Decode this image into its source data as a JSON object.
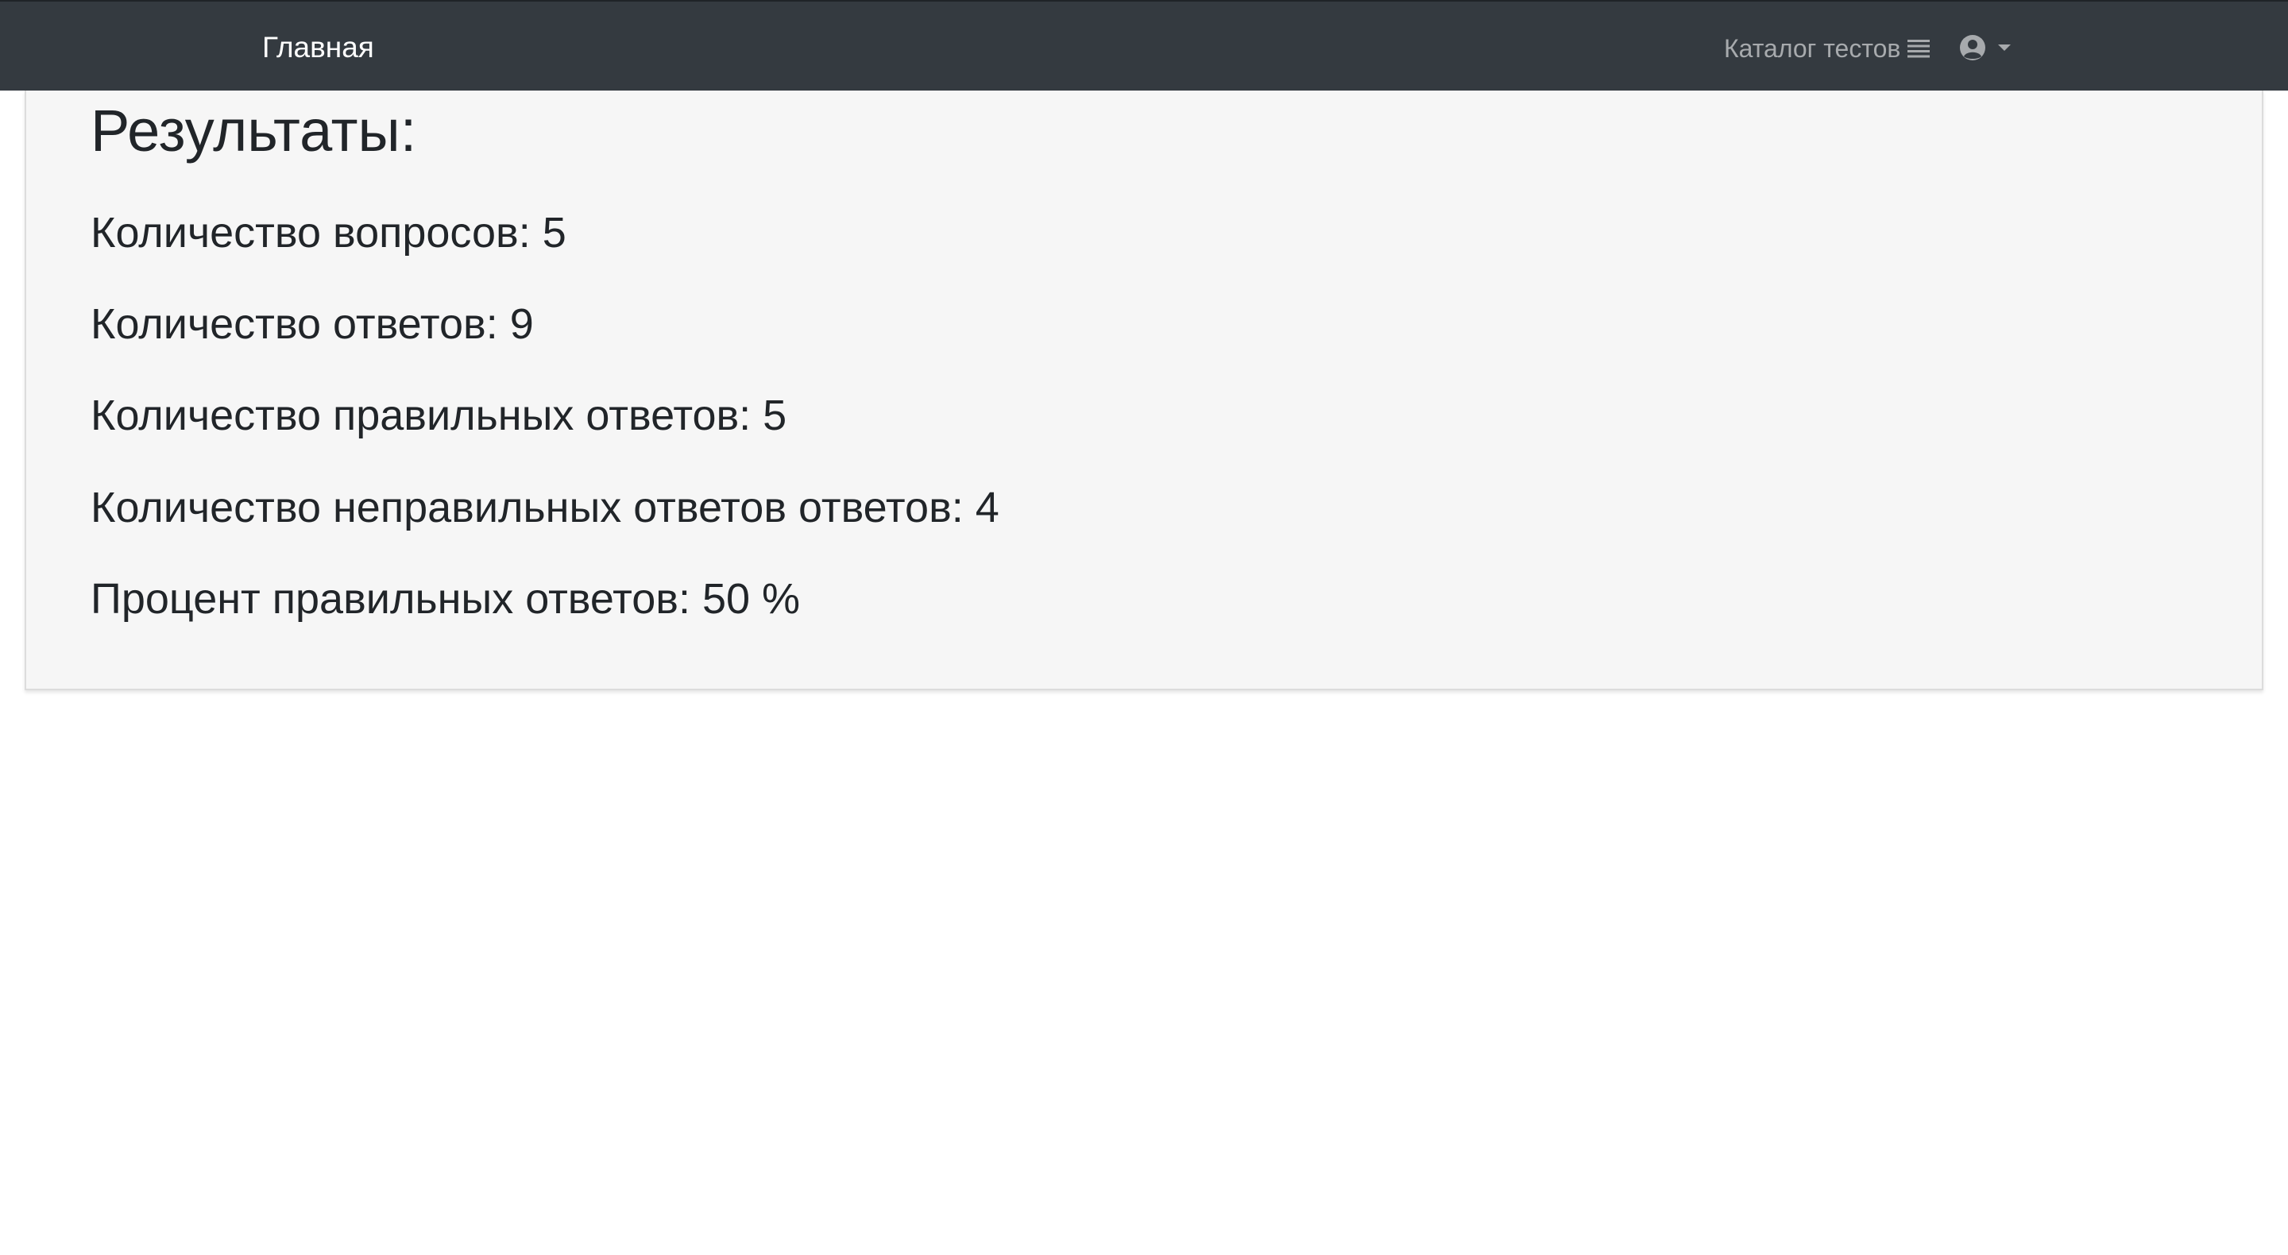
{
  "navbar": {
    "home_label": "Главная",
    "catalog_label": "Каталог тестов",
    "catalog_icon": "list-icon",
    "user_icon": "user-circle-icon",
    "dropdown_icon": "caret-down-icon",
    "background_color": "#343a40"
  },
  "results": {
    "title": "Результаты:",
    "stats": [
      "Количество вопросов: 5",
      "Количество ответов: 9",
      "Количество правильных ответов: 5",
      "Количество неправильных ответов ответов: 4",
      "Процент правильных ответов: 50 %"
    ]
  }
}
